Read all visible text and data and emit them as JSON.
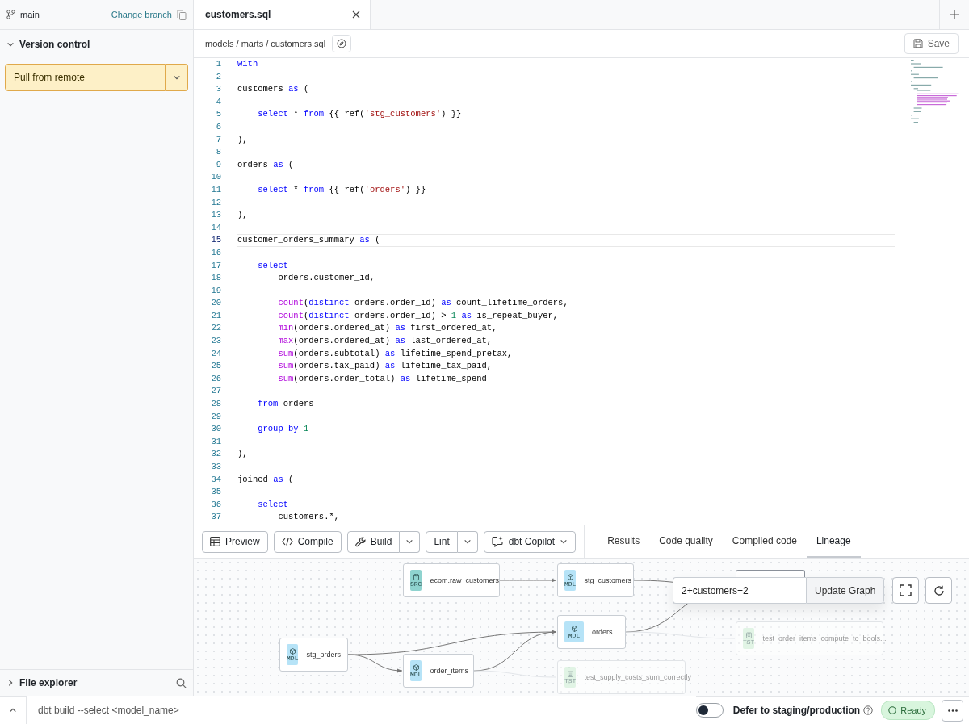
{
  "sidebar": {
    "branch": "main",
    "change_branch": "Change branch",
    "version_control": {
      "title": "Version control",
      "expanded": true
    },
    "pull_button": "Pull from remote",
    "file_explorer": {
      "title": "File explorer",
      "expanded": false
    }
  },
  "editor": {
    "tab": "customers.sql",
    "breadcrumb": "models / marts / customers.sql",
    "save": "Save",
    "lines": [
      {
        "number": "1",
        "current": false,
        "text": "with"
      },
      {
        "number": "2",
        "current": false
      },
      {
        "number": "3",
        "current": false,
        "text": "customers as ("
      },
      {
        "number": "4",
        "current": false
      },
      {
        "number": "5",
        "current": false,
        "text": "    select * from {{ ref('stg_customers') }}"
      },
      {
        "number": "6",
        "current": false
      },
      {
        "number": "7",
        "current": false,
        "text": "),"
      },
      {
        "number": "8",
        "current": false
      },
      {
        "number": "9",
        "current": false,
        "text": "orders as ("
      },
      {
        "number": "10",
        "current": false
      },
      {
        "number": "11",
        "current": false,
        "text": "    select * from {{ ref('orders') }}"
      },
      {
        "number": "12",
        "current": false
      },
      {
        "number": "13",
        "current": false,
        "text": "),"
      },
      {
        "number": "14",
        "current": false
      },
      {
        "number": "15",
        "current": true,
        "text": "customer_orders_summary as ("
      },
      {
        "number": "16",
        "current": false
      },
      {
        "number": "17",
        "current": false,
        "text": "    select"
      },
      {
        "number": "18",
        "current": false,
        "text": "        orders.customer_id,"
      },
      {
        "number": "19",
        "current": false
      },
      {
        "number": "20",
        "current": false,
        "text": "        count(distinct orders.order_id) as count_lifetime_orders,"
      },
      {
        "number": "21",
        "current": false,
        "text": "        count(distinct orders.order_id) > 1 as is_repeat_buyer,"
      },
      {
        "number": "22",
        "current": false,
        "text": "        min(orders.ordered_at) as first_ordered_at,"
      },
      {
        "number": "23",
        "current": false,
        "text": "        max(orders.ordered_at) as last_ordered_at,"
      },
      {
        "number": "24",
        "current": false,
        "text": "        sum(orders.subtotal) as lifetime_spend_pretax,"
      },
      {
        "number": "25",
        "current": false,
        "text": "        sum(orders.tax_paid) as lifetime_tax_paid,"
      },
      {
        "number": "26",
        "current": false,
        "text": "        sum(orders.order_total) as lifetime_spend"
      },
      {
        "number": "27",
        "current": false
      },
      {
        "number": "28",
        "current": false,
        "text": "    from orders"
      },
      {
        "number": "29",
        "current": false
      },
      {
        "number": "30",
        "current": false,
        "text": "    group by 1"
      },
      {
        "number": "31",
        "current": false
      },
      {
        "number": "32",
        "current": false,
        "text": "),"
      },
      {
        "number": "33",
        "current": false
      },
      {
        "number": "34",
        "current": false,
        "text": "joined as ("
      },
      {
        "number": "35",
        "current": false
      },
      {
        "number": "36",
        "current": false,
        "text": "    select"
      },
      {
        "number": "37",
        "current": false,
        "text": "        customers.*,"
      }
    ]
  },
  "toolbar": [
    {
      "label": "Preview",
      "split": false,
      "caret": false
    },
    {
      "label": "Compile",
      "split": false,
      "caret": false
    },
    {
      "label": "Build",
      "split": true,
      "caret": true
    },
    {
      "label": "Lint",
      "split": true,
      "caret": true
    },
    {
      "label": "dbt Copilot",
      "split": false,
      "caret": true
    }
  ],
  "panel_tabs": [
    {
      "label": "Results",
      "selected": false
    },
    {
      "label": "Code quality",
      "selected": false
    },
    {
      "label": "Compiled code",
      "selected": false
    },
    {
      "label": "Lineage",
      "selected": true
    }
  ],
  "lineage": {
    "nodes": [
      {
        "kind": "src",
        "badge": "SRC",
        "label": "ecom.raw_customers",
        "faded": false
      },
      {
        "kind": "mdl",
        "badge": "MDL",
        "label": "stg_customers",
        "faded": false
      },
      {
        "kind": "mdl",
        "badge": "MDL",
        "label": "orders",
        "faded": false
      },
      {
        "kind": "mdl",
        "badge": "MDL",
        "label": "stg_orders",
        "faded": false
      },
      {
        "kind": "mdl",
        "badge": "MDL",
        "label": "order_items",
        "faded": false
      },
      {
        "kind": "tst",
        "badge": "TST",
        "label": "test_order_items_compute_to_bools...",
        "faded": true
      },
      {
        "kind": "tst",
        "badge": "TST",
        "label": "test_supply_costs_sum_correctly",
        "faded": true
      }
    ],
    "selector": {
      "value": "2+customers+2"
    },
    "update_button": "Update Graph"
  },
  "status_bar": {
    "command": {
      "placeholder": "dbt build --select <model_name>"
    },
    "defer": {
      "label": "Defer to staging/production",
      "on": false
    },
    "status": "Ready"
  }
}
